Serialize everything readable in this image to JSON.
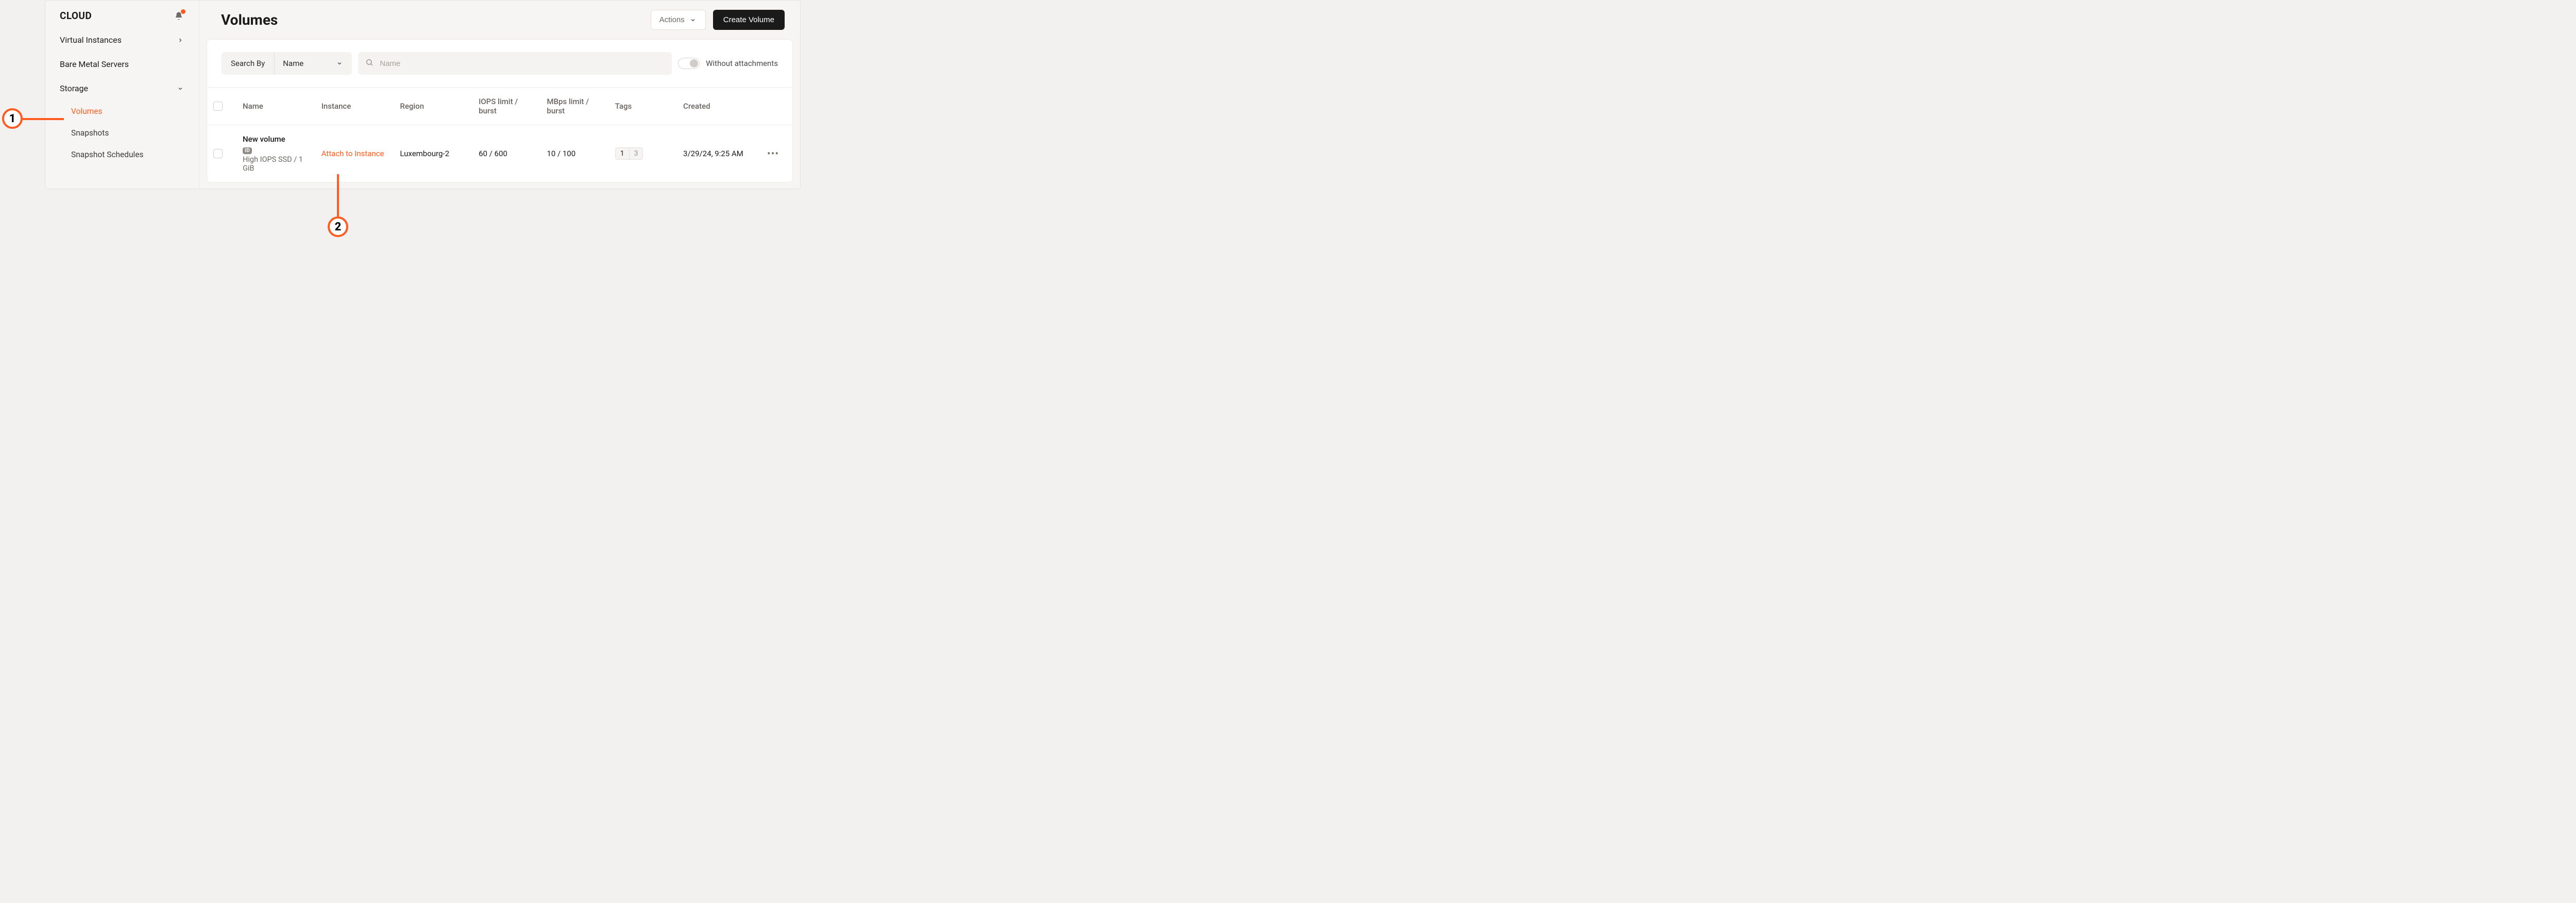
{
  "sidebar": {
    "title": "CLOUD",
    "items": {
      "virtual_instances": "Virtual Instances",
      "bare_metal": "Bare Metal Servers",
      "storage": "Storage"
    },
    "storage_sub": {
      "volumes": "Volumes",
      "snapshots": "Snapshots",
      "snapshot_schedules": "Snapshot Schedules"
    }
  },
  "page": {
    "title": "Volumes",
    "actions_label": "Actions",
    "create_label": "Create Volume"
  },
  "filters": {
    "search_by_label": "Search By",
    "search_by_field": "Name",
    "search_placeholder": "Name",
    "without_attachments_label": "Without attachments"
  },
  "columns": {
    "name": "Name",
    "instance": "Instance",
    "region": "Region",
    "iops": "IOPS limit / burst",
    "mbps": "MBps limit / burst",
    "tags": "Tags",
    "created": "Created"
  },
  "row": {
    "name_title": "New volume",
    "id_badge": "ID",
    "name_sub": "High IOPS SSD / 1 GiB",
    "instance_action": "Attach to Instance",
    "region": "Luxembourg-2",
    "iops": "60 / 600",
    "mbps": "10 / 100",
    "tag1": "1",
    "tag2": "3",
    "created": "3/29/24, 9:25 AM"
  },
  "callouts": {
    "c1": "1",
    "c2": "2"
  }
}
